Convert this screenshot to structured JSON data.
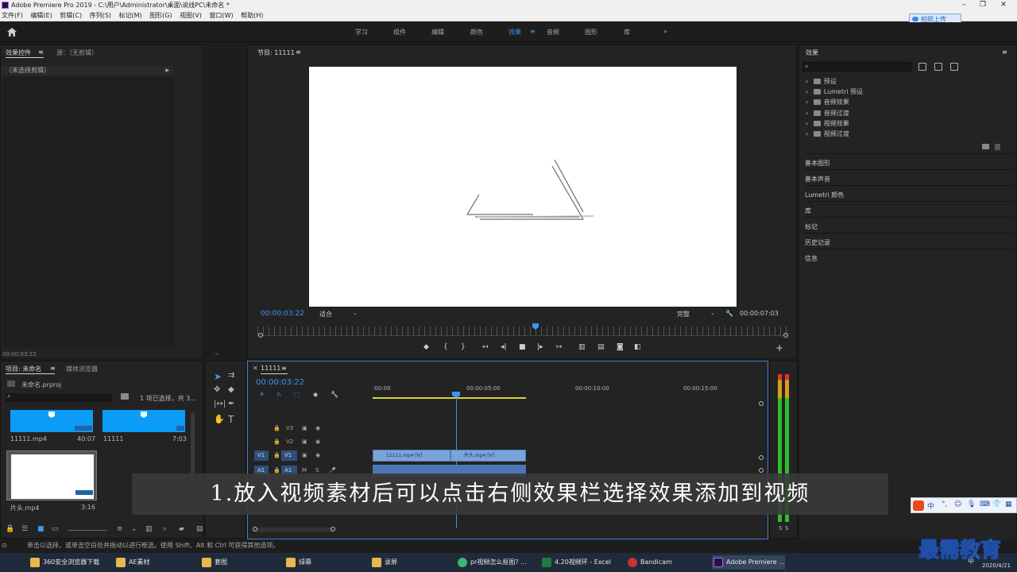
{
  "titlebar": {
    "title": "Adobe Premiere Pro 2019 - C:\\用户\\Administrator\\桌面\\说线PC\\未命名 *"
  },
  "menu": [
    "文件(F)",
    "编辑(E)",
    "剪辑(C)",
    "序列(S)",
    "标记(M)",
    "图形(G)",
    "视图(V)",
    "窗口(W)",
    "帮助(H)"
  ],
  "upload_label": "拍照上传",
  "workspaces": [
    "学习",
    "组件",
    "编辑",
    "颜色",
    "效果",
    "音频",
    "图形",
    "库"
  ],
  "workspace_more": "»",
  "effect_controls": {
    "tab": "效果控件",
    "tab_menu": "≡",
    "source_tab": "源：（无剪辑）",
    "empty": "（未选择剪辑）",
    "arrow": "▶",
    "timecode": "00:00:03:22"
  },
  "program": {
    "title": "节目: 11111",
    "title_menu": "≡",
    "timecode": "00:00:03:22",
    "fit": "适合",
    "quality": "完整",
    "duration": "00:00:07:03"
  },
  "effects": {
    "title": "效果",
    "menu": "≡",
    "search_icon": "⌕",
    "items": [
      "预设",
      "Lumetri 预设",
      "音频效果",
      "音频过渡",
      "视频效果",
      "视频过渡"
    ],
    "sections": [
      "基本图形",
      "基本声音",
      "Lumetri 颜色",
      "库",
      "标记",
      "历史记录",
      "信息"
    ]
  },
  "project": {
    "tab": "项目: 未命名",
    "tab_menu": "≡",
    "browser_tab": "媒体浏览器",
    "file": "未命名.prproj",
    "selection": "1 项已选择，共 3...",
    "clips": [
      {
        "name": "11111.mp4",
        "duration": "40:07"
      },
      {
        "name": "11111",
        "duration": "7:03"
      },
      {
        "name": "片头.mp4",
        "duration": "3:16"
      }
    ]
  },
  "timeline": {
    "tab": "11111",
    "tab_menu": "≡",
    "timecode": "00:00:03:22",
    "ruler": [
      ":00:00",
      "00:00:05:00",
      "00:00:10:00",
      "00:00:15:00"
    ],
    "tracks": [
      "V3",
      "V2",
      "V1",
      "A1"
    ],
    "targets": [
      "V1",
      "A1"
    ],
    "clips": [
      "11111.mp4 [V]",
      "片头.mp4 [V]"
    ]
  },
  "meter": {
    "labels": [
      "S",
      "S"
    ]
  },
  "subtitle": "1.放入视频素材后可以点击右侧效果栏选择效果添加到视频",
  "status": "单击以选择，或单击空白处并拖动以进行框选。使用 Shift、Alt 和 Ctrl 可获得其他选项。",
  "taskbar": [
    {
      "label": "360安全浏览器下载",
      "color": "#e8b84a"
    },
    {
      "label": "AE素材",
      "color": "#e8b84a"
    },
    {
      "label": "套图",
      "color": "#e8b84a"
    },
    {
      "label": "绿幕",
      "color": "#e8b84a"
    },
    {
      "label": "录屏",
      "color": "#e8b84a"
    },
    {
      "label": "pr视频怎么抠图? ...",
      "color": "#3cb371"
    },
    {
      "label": "4.20视频环 - Excel",
      "color": "#1f7a40"
    },
    {
      "label": "Bandicam",
      "color": "#c83232"
    },
    {
      "label": "Adobe Premiere ...",
      "color": "#2b0f3f"
    }
  ],
  "tray": {
    "date": "2020/4/21",
    "ime": "中"
  },
  "watermark": "最需教育"
}
